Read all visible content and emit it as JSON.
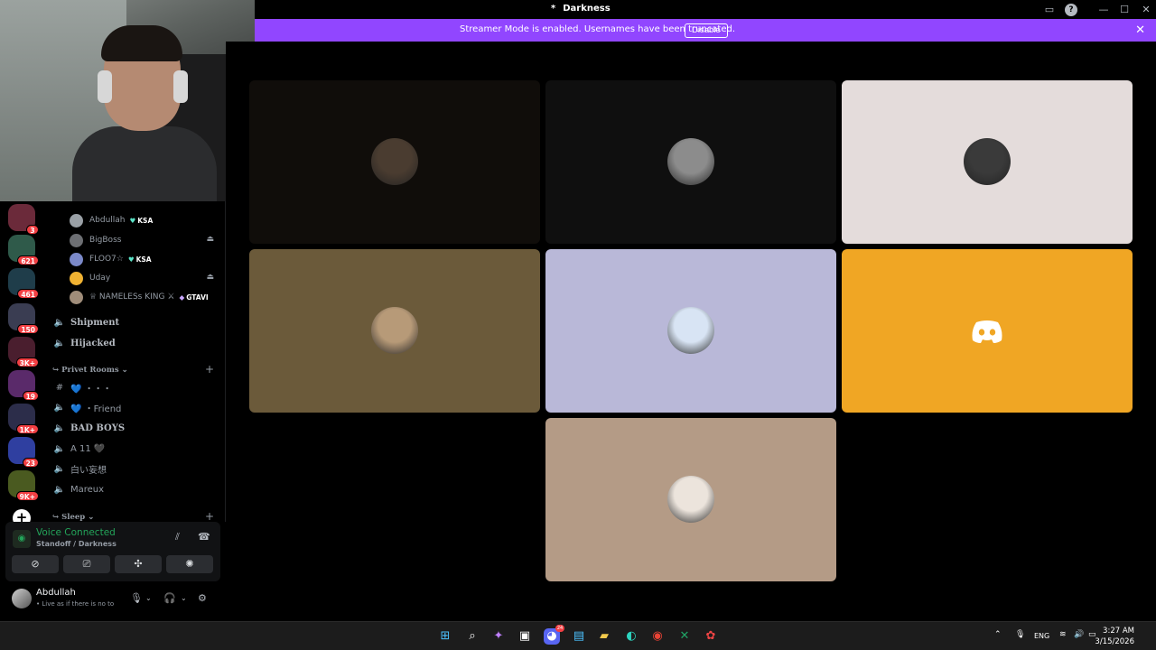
{
  "window": {
    "title": "Darkness",
    "title_prefix": "*"
  },
  "banner": {
    "text": "Streamer Mode is enabled. Usernames have been truncated.",
    "button": "Disable"
  },
  "servers": [
    {
      "badge": "3",
      "color": "#6b2a3a"
    },
    {
      "badge": "621",
      "color": "#2f5a4a"
    },
    {
      "badge": "461",
      "color": "#1f3d4a"
    },
    {
      "badge": "150",
      "color": "#3a3d52"
    },
    {
      "badge": "3K+",
      "color": "#4a1e2e"
    },
    {
      "badge": "19",
      "color": "#5a2a6a"
    },
    {
      "badge": "1K+",
      "color": "#2c2d4a"
    },
    {
      "badge": "23",
      "color": "#2f3fa0"
    },
    {
      "badge": "9K+",
      "color": "#4a5a20"
    }
  ],
  "members": [
    {
      "name": "Abdullah",
      "tag": "KSA",
      "avatar": "#9aa0a6"
    },
    {
      "name": "BigBoss",
      "avatar": "#6d6f73",
      "console": "ps-icon"
    },
    {
      "name": "FLOO7☆",
      "tag": "KSA",
      "avatar": "#7b89c9"
    },
    {
      "name": "Uday",
      "avatar": "#f0b232",
      "console": "ps-icon"
    },
    {
      "name": "♕ NAMELESs KING ⚔",
      "tag": "GTAVI",
      "avatar": "#a08d7a"
    }
  ],
  "channels": [
    {
      "name": "Shipment",
      "type": "voice"
    },
    {
      "name": "Hijacked",
      "type": "voice"
    }
  ],
  "category_privet": "Privet Rooms",
  "privet_channels": [
    {
      "name": "💙 ・・・",
      "type": "text"
    },
    {
      "name": "💙 ・Friend",
      "type": "voice"
    },
    {
      "name": "BAD BOYS",
      "type": "voice"
    },
    {
      "name": "A 11 🖤",
      "type": "voice"
    },
    {
      "name": "白い妄想",
      "type": "voice"
    },
    {
      "name": "Mareux",
      "type": "voice"
    }
  ],
  "category_sleep": "Sleep",
  "voice": {
    "status": "Voice Connected",
    "location": "Standoff / Darkness"
  },
  "user": {
    "name": "Abdullah",
    "status": "• Live as if there is no to"
  },
  "tiles": [
    {
      "bg": "#100d0a",
      "pfp": "#4a3c30"
    },
    {
      "bg": "#0f0f0f",
      "pfp": "#8c8c8c"
    },
    {
      "bg": "#e4dcdb",
      "pfp": "#3a3a3a"
    },
    {
      "bg": "#6b5a3a",
      "pfp": "#b79a78"
    },
    {
      "bg": "#b9b8d8",
      "pfp": "#d8e4f4"
    },
    {
      "bg": "#f0a624",
      "pfp": "discord-logo"
    },
    {
      "bg": "#b49b86",
      "pfp": "#ece4dc"
    }
  ],
  "taskbar": {
    "lang": "ENG",
    "time": "3:27 AM",
    "date": "3/15/2026",
    "discord_badge": "24"
  }
}
